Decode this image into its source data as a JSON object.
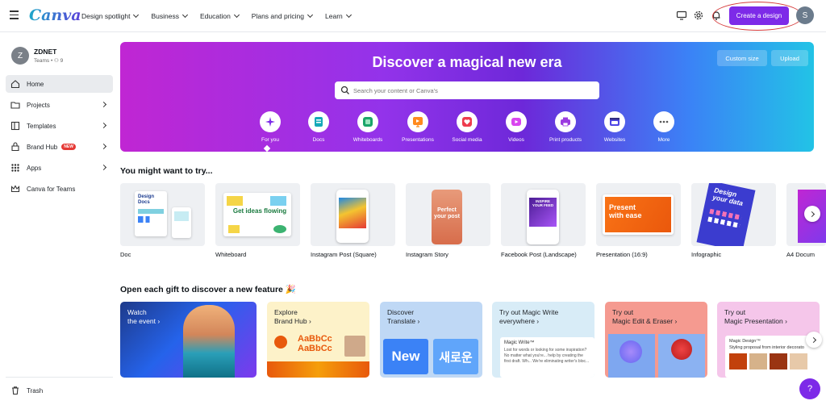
{
  "topbar": {
    "logo": "Canva",
    "nav": [
      "Design spotlight",
      "Business",
      "Education",
      "Plans and pricing",
      "Learn"
    ],
    "create_label": "Create a design",
    "avatar_initial": "S",
    "icons": [
      "monitor-icon",
      "gear-icon",
      "bell-icon"
    ]
  },
  "sidebar": {
    "team_initial": "Z",
    "team_name": "ZDNET",
    "team_meta": "Teams • ⚇ 9",
    "items": [
      {
        "label": "Home",
        "icon": "home-icon",
        "active": true
      },
      {
        "label": "Projects",
        "icon": "folder-icon"
      },
      {
        "label": "Templates",
        "icon": "templates-icon"
      },
      {
        "label": "Brand Hub",
        "icon": "brand-icon",
        "badge": "NEW"
      },
      {
        "label": "Apps",
        "icon": "apps-icon"
      },
      {
        "label": "Canva for Teams",
        "icon": "crown-icon"
      }
    ],
    "trash_label": "Trash"
  },
  "hero": {
    "title": "Discover a magical new era",
    "custom_size": "Custom size",
    "upload": "Upload",
    "search_placeholder": "Search your content or Canva's",
    "categories": [
      "For you",
      "Docs",
      "Whiteboards",
      "Presentations",
      "Social media",
      "Videos",
      "Print products",
      "Websites",
      "More"
    ]
  },
  "try_section": {
    "title": "You might want to try...",
    "cards": [
      "Doc",
      "Whiteboard",
      "Instagram Post (Square)",
      "Instagram Story",
      "Facebook Post (Landscape)",
      "Presentation (16:9)",
      "Infographic",
      "A4 Docum"
    ],
    "thumb_text": {
      "doc": "Design Docs",
      "whiteboard": "Get ideas flowing",
      "story": "Perfect your post",
      "facebook": "INSPIRE YOUR FEED",
      "presentation": "Present with ease",
      "infographic": "Design your data"
    }
  },
  "gift_section": {
    "title": "Open each gift to discover a new feature 🎉",
    "features": [
      {
        "line1": "Watch",
        "line2": "the event ›"
      },
      {
        "line1": "Explore",
        "line2": "Brand Hub ›"
      },
      {
        "line1": "Discover",
        "line2": "Translate ›"
      },
      {
        "line1": "Try out Magic Write",
        "line2": "everywhere ›"
      },
      {
        "line1": "Try out",
        "line2": "Magic Edit & Eraser ›"
      },
      {
        "line1": "Try out",
        "line2": "Magic Presentation ›"
      }
    ],
    "brand_text": "AaBbCc",
    "translate_en": "New",
    "translate_ko": "새로운",
    "magic_write_label": "Magic Write™",
    "magic_write_body": "Lost for words or looking for some inspiration? No matter what you're... help by creating the first draft. Wh... We're eliminating writer's bloc...",
    "magic_design_label": "Magic Design™",
    "magic_design_body": "Styling proposal from interior decorato"
  },
  "help_label": "?"
}
